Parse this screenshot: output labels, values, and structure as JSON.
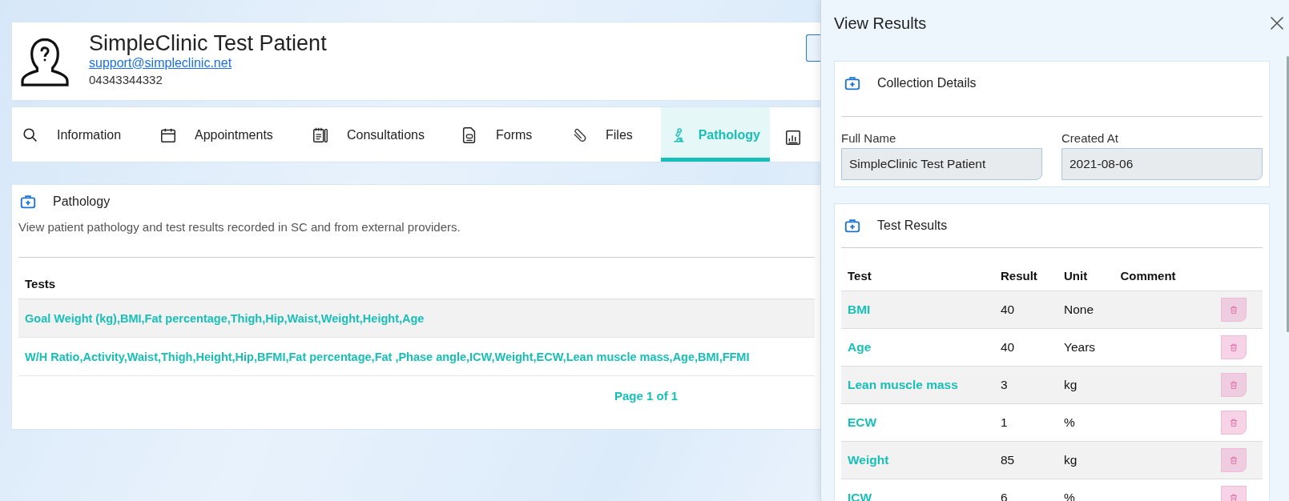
{
  "patient": {
    "name": "SimpleClinic Test Patient",
    "email": "support@simpleclinic.net",
    "phone": "04343344332"
  },
  "tabs": [
    {
      "label": "Information",
      "selected": false
    },
    {
      "label": "Appointments",
      "selected": false
    },
    {
      "label": "Consultations",
      "selected": false
    },
    {
      "label": "Forms",
      "selected": false
    },
    {
      "label": "Files",
      "selected": false
    },
    {
      "label": "Pathology",
      "selected": true
    }
  ],
  "pathology": {
    "title": "Pathology",
    "description": "View patient pathology and test results recorded in SC and from external providers.",
    "columns": [
      "Tests"
    ],
    "rows": [
      "Goal Weight (kg),BMI,Fat percentage,Thigh,Hip,Waist,Weight,Height,Age",
      "W/H Ratio,Activity,Waist,Thigh,Height,Hip,BFMI,Fat percentage,Fat ,Phase angle,ICW,Weight,ECW,Lean muscle mass,Age,BMI,FFMI"
    ],
    "pagination": "Page 1 of 1"
  },
  "panel": {
    "title": "View Results",
    "collection": {
      "title": "Collection Details",
      "fields": [
        {
          "label": "Full Name",
          "value": "SimpleClinic Test Patient"
        },
        {
          "label": "Created At",
          "value": "2021-08-06"
        }
      ]
    },
    "results": {
      "title": "Test Results",
      "columns": [
        "Test",
        "Result",
        "Unit",
        "Comment"
      ],
      "rows": [
        {
          "test": "BMI",
          "result": "40",
          "unit": "None"
        },
        {
          "test": "Age",
          "result": "40",
          "unit": "Years"
        },
        {
          "test": "Lean muscle mass",
          "result": "3",
          "unit": "kg"
        },
        {
          "test": "ECW",
          "result": "1",
          "unit": "%"
        },
        {
          "test": "Weight",
          "result": "85",
          "unit": "kg"
        },
        {
          "test": "ICW",
          "result": "6",
          "unit": "%"
        }
      ]
    }
  }
}
